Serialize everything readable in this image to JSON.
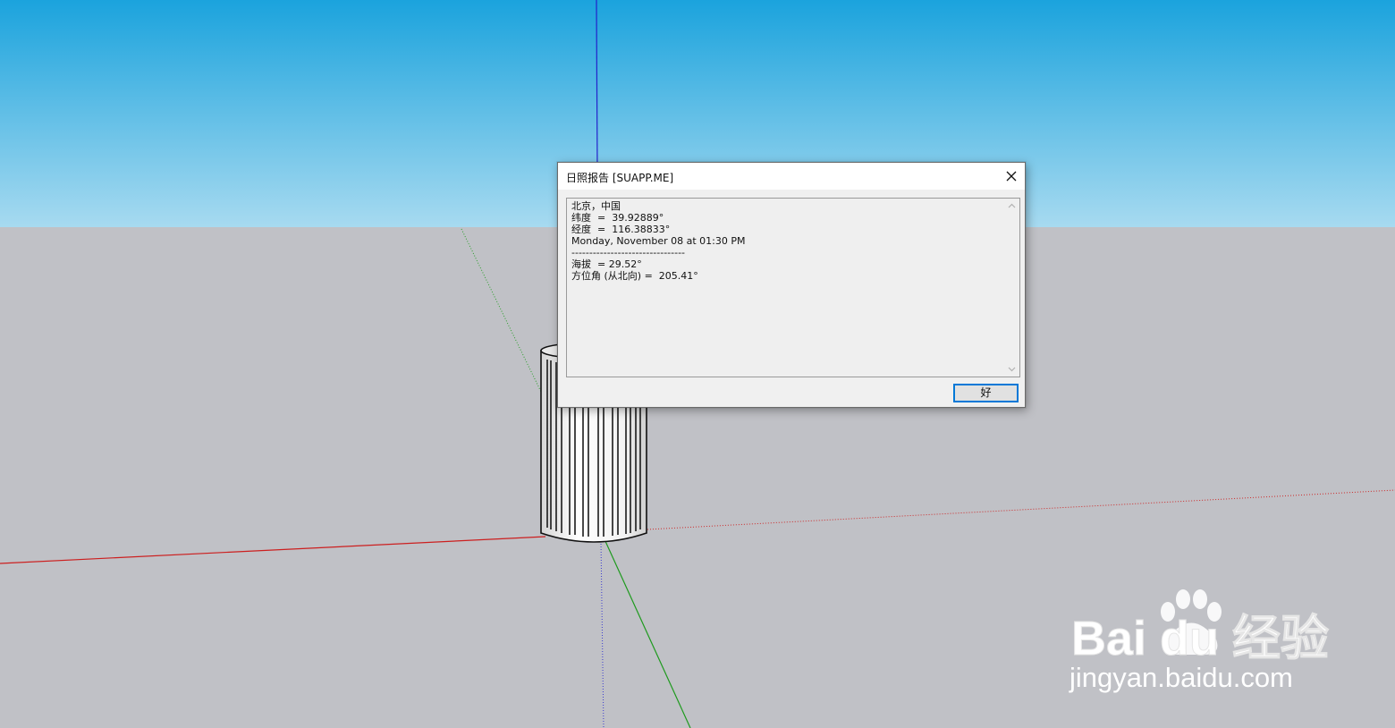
{
  "dialog": {
    "title": "日照报告 [SUAPP.ME]",
    "report_lines": {
      "location": "北京，中国",
      "latitude": "纬度  =  39.92889°",
      "longitude": "经度  =  116.38833°",
      "datetime": "Monday, November 08 at 01:30 PM",
      "separator": "--------------------------------",
      "altitude": "海拔  = 29.52°",
      "azimuth": "方位角 (从北向) =  205.41°"
    },
    "ok_label": "好"
  },
  "watermark": {
    "brand": "Bai du 经验",
    "url": "jingyan.baidu.com"
  },
  "colors": {
    "sky_top": "#1ba3dd",
    "sky_bottom": "#a7daf0",
    "ground": "#c0c1c6",
    "red_axis": "#cc1f1f",
    "green_axis": "#1e9a1e",
    "blue_axis": "#2222cc",
    "dialog_accent": "#0078d7"
  }
}
